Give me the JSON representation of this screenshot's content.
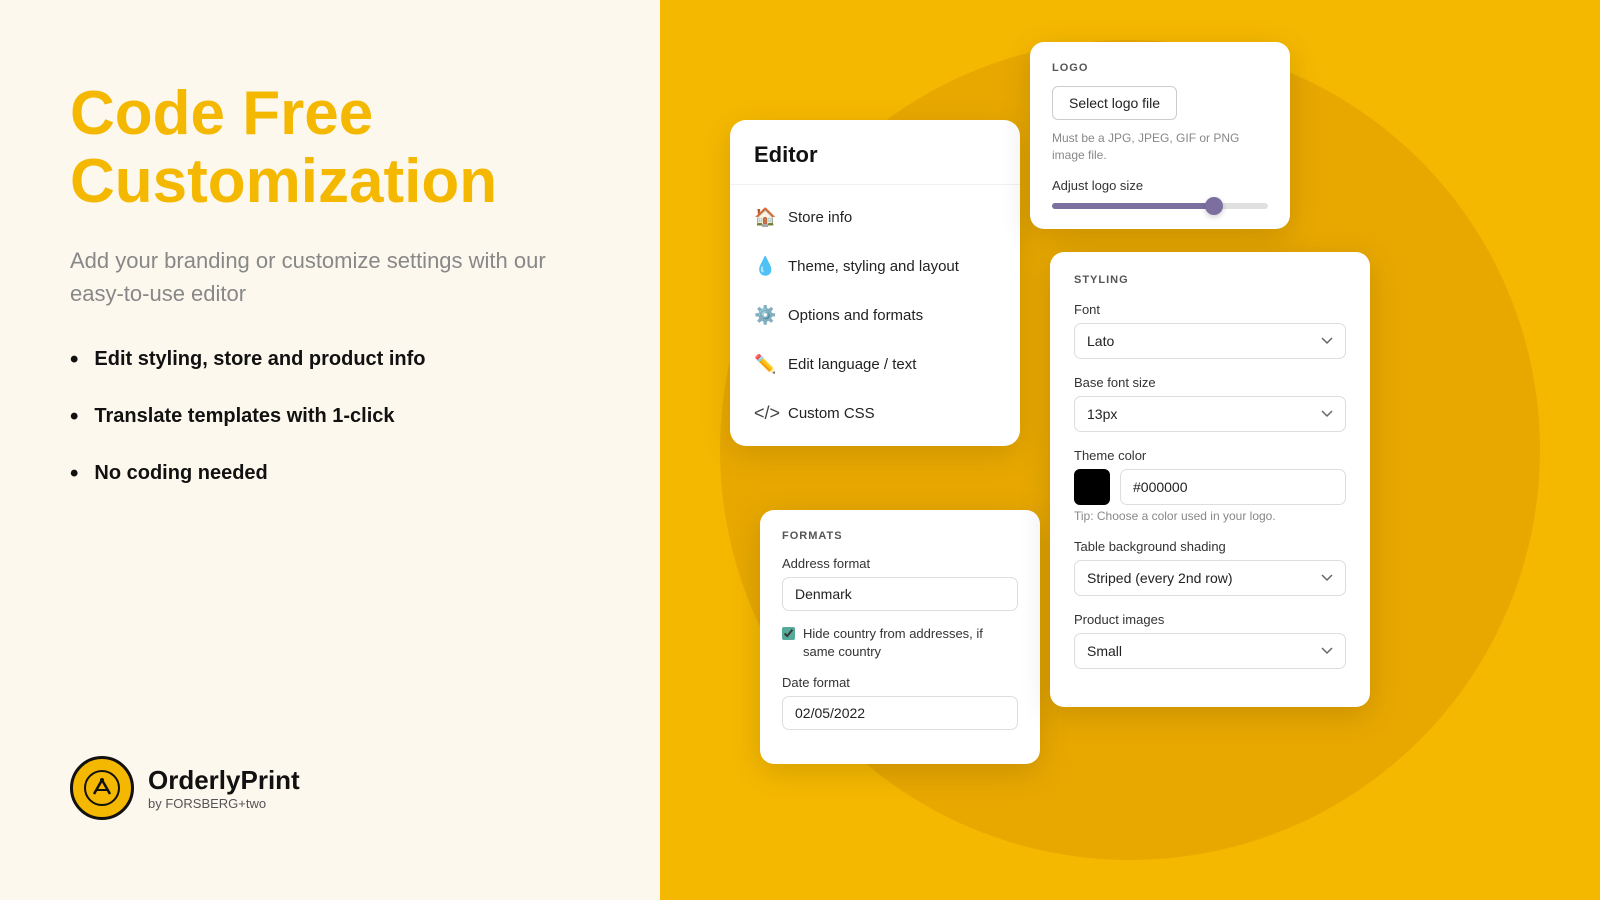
{
  "left": {
    "title_line1": "Code Free",
    "title_line2": "Customization",
    "subtitle": "Add your branding or customize settings with our easy-to-use editor",
    "bullets": [
      "Edit styling, store and product info",
      "Translate templates with 1-click",
      "No coding needed"
    ],
    "logo_name": "OrderlyPrint",
    "logo_sub": "by FORSBERG+two"
  },
  "right": {
    "editor": {
      "header": "Editor",
      "menu_items": [
        {
          "icon": "🏠",
          "label": "Store info"
        },
        {
          "icon": "💧",
          "label": "Theme, styling and layout"
        },
        {
          "icon": "⚙️",
          "label": "Options and formats"
        },
        {
          "icon": "✏️",
          "label": "Edit language / text"
        },
        {
          "icon": "</>",
          "label": "Custom CSS"
        }
      ]
    },
    "logo_card": {
      "label": "LOGO",
      "button": "Select logo file",
      "hint": "Must be a JPG, JPEG, GIF or PNG image file.",
      "adjust_label": "Adjust logo size"
    },
    "styling_card": {
      "label": "STYLING",
      "font_label": "Font",
      "font_value": "Lato",
      "font_size_label": "Base font size",
      "font_size_value": "13px",
      "theme_color_label": "Theme color",
      "theme_color_hex": "#000000",
      "theme_color_tip": "Tip: Choose a color used in your logo.",
      "table_bg_label": "Table background shading",
      "table_bg_value": "Striped (every 2nd row)",
      "product_images_label": "Product images",
      "product_images_value": "Small"
    },
    "formats_card": {
      "label": "FORMATS",
      "address_label": "Address format",
      "address_value": "Denmark",
      "checkbox_label": "Hide country from addresses, if same country",
      "date_label": "Date format",
      "date_value": "02/05/2022"
    }
  }
}
